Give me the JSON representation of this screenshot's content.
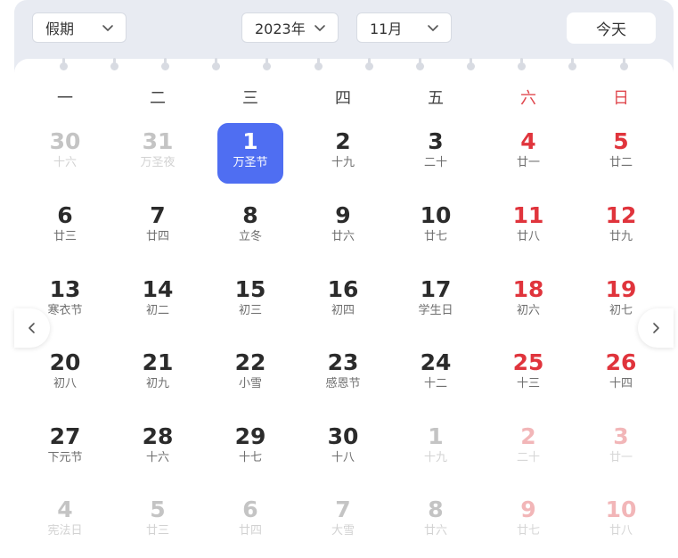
{
  "toolbar": {
    "holiday_select": "假期",
    "year_select": "2023年",
    "month_select": "11月",
    "today_button": "今天"
  },
  "weekdays": [
    "一",
    "二",
    "三",
    "四",
    "五",
    "六",
    "日"
  ],
  "weeks": [
    [
      {
        "day": "30",
        "sub": "十六",
        "out": true
      },
      {
        "day": "31",
        "sub": "万圣夜",
        "out": true
      },
      {
        "day": "1",
        "sub": "万圣节",
        "selected": true
      },
      {
        "day": "2",
        "sub": "十九"
      },
      {
        "day": "3",
        "sub": "二十"
      },
      {
        "day": "4",
        "sub": "廿一"
      },
      {
        "day": "5",
        "sub": "廿二"
      }
    ],
    [
      {
        "day": "6",
        "sub": "廿三"
      },
      {
        "day": "7",
        "sub": "廿四"
      },
      {
        "day": "8",
        "sub": "立冬"
      },
      {
        "day": "9",
        "sub": "廿六"
      },
      {
        "day": "10",
        "sub": "廿七"
      },
      {
        "day": "11",
        "sub": "廿八"
      },
      {
        "day": "12",
        "sub": "廿九"
      }
    ],
    [
      {
        "day": "13",
        "sub": "寒衣节"
      },
      {
        "day": "14",
        "sub": "初二"
      },
      {
        "day": "15",
        "sub": "初三"
      },
      {
        "day": "16",
        "sub": "初四"
      },
      {
        "day": "17",
        "sub": "学生日"
      },
      {
        "day": "18",
        "sub": "初六"
      },
      {
        "day": "19",
        "sub": "初七"
      }
    ],
    [
      {
        "day": "20",
        "sub": "初八"
      },
      {
        "day": "21",
        "sub": "初九"
      },
      {
        "day": "22",
        "sub": "小雪"
      },
      {
        "day": "23",
        "sub": "感恩节"
      },
      {
        "day": "24",
        "sub": "十二"
      },
      {
        "day": "25",
        "sub": "十三"
      },
      {
        "day": "26",
        "sub": "十四"
      }
    ],
    [
      {
        "day": "27",
        "sub": "下元节"
      },
      {
        "day": "28",
        "sub": "十六"
      },
      {
        "day": "29",
        "sub": "十七"
      },
      {
        "day": "30",
        "sub": "十八"
      },
      {
        "day": "1",
        "sub": "十九",
        "out": true
      },
      {
        "day": "2",
        "sub": "二十",
        "out": true
      },
      {
        "day": "3",
        "sub": "廿一",
        "out": true
      }
    ],
    [
      {
        "day": "4",
        "sub": "宪法日",
        "out": true
      },
      {
        "day": "5",
        "sub": "廿三",
        "out": true
      },
      {
        "day": "6",
        "sub": "廿四",
        "out": true
      },
      {
        "day": "7",
        "sub": "大雪",
        "out": true
      },
      {
        "day": "8",
        "sub": "廿六",
        "out": true
      },
      {
        "day": "9",
        "sub": "廿七",
        "out": true
      },
      {
        "day": "10",
        "sub": "廿八",
        "out": true
      }
    ]
  ],
  "colors": {
    "selected": "#4f6ef2",
    "weekend": "#e0343c",
    "frame": "#e8ebf2"
  },
  "icons": {
    "prev": "chevron-left-icon",
    "next": "chevron-right-icon",
    "dropdown": "chevron-down-icon"
  }
}
